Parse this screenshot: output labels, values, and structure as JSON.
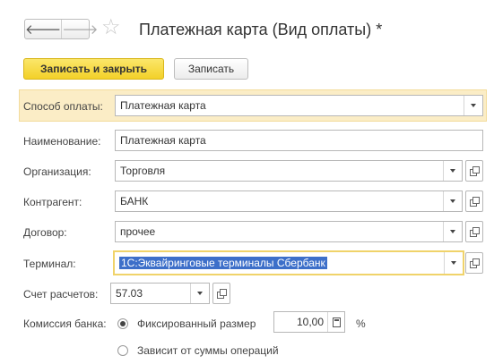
{
  "header": {
    "back_arrow": "🡐",
    "forward_arrow": "🡒",
    "star": "☆",
    "title": "Платежная карта (Вид оплаты) *"
  },
  "toolbar": {
    "save_close_label": "Записать и закрыть",
    "save_label": "Записать"
  },
  "form": {
    "payment_method": {
      "label": "Способ оплаты:",
      "value": "Платежная карта"
    },
    "name": {
      "label": "Наименование:",
      "value": "Платежная карта"
    },
    "organization": {
      "label": "Организация:",
      "value": "Торговля"
    },
    "counterparty": {
      "label": "Контрагент:",
      "value": "БАНК"
    },
    "contract": {
      "label": "Договор:",
      "value": "прочее"
    },
    "terminal": {
      "label": "Терминал:",
      "value": "1С:Эквайринговые терминалы Сбербанк"
    },
    "settlement_account": {
      "label": "Счет расчетов:",
      "value": "57.03"
    },
    "bank_commission": {
      "label": "Комиссия банка:",
      "option_fixed": "Фиксированный размер",
      "fixed_value": "10,00",
      "percent_sign": "%",
      "option_depends": "Зависит от суммы операций",
      "selected": "option_fixed"
    }
  },
  "colors": {
    "accent_button": "#f3d128",
    "highlight_band": "#fbedc6",
    "selection": "#3d6fc9"
  }
}
